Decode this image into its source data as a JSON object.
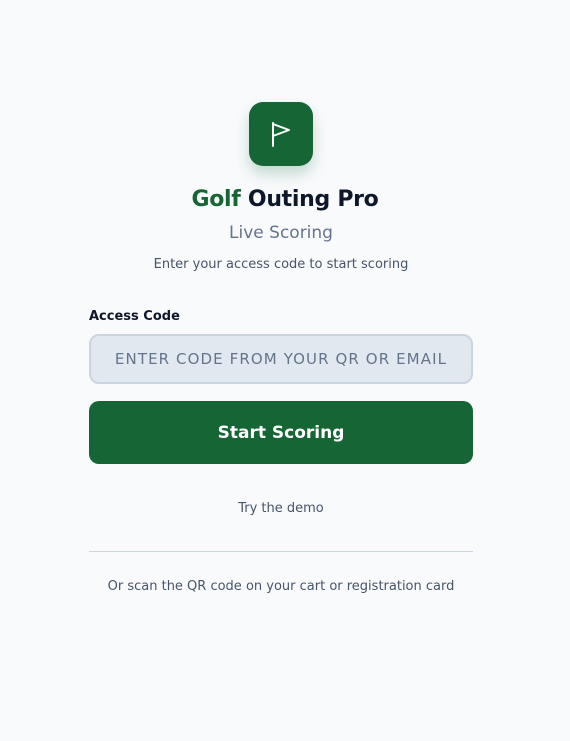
{
  "brand": {
    "title_accent": "Golf",
    "title_rest": "Outing Pro",
    "subtitle": "Live Scoring",
    "logo_icon": "flag-icon",
    "accent_color": "#166534"
  },
  "login": {
    "instructions": "Enter your access code to start scoring",
    "field_label": "Access Code",
    "code_value": "",
    "code_placeholder": "Enter code from your QR or email",
    "submit_label": "Start Scoring",
    "demo_link": "Try the demo",
    "footer_note": "Or scan the QR code on your cart or registration card"
  }
}
